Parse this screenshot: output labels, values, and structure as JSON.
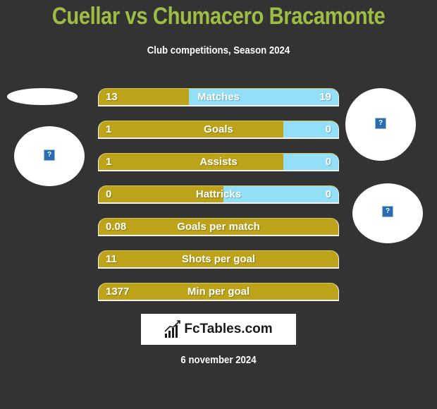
{
  "header": {
    "title": "Cuellar vs Chumacero Bracamonte",
    "subtitle": "Club competitions, Season 2024"
  },
  "colors": {
    "title": "#9dbd45",
    "left_bar": "#bca31a",
    "right_bar": "#93dff7",
    "background": "#333333"
  },
  "stats": [
    {
      "label": "Matches",
      "left": "13",
      "right": "19",
      "left_share": 0.375
    },
    {
      "label": "Goals",
      "left": "1",
      "right": "0",
      "left_share": 0.77
    },
    {
      "label": "Assists",
      "left": "1",
      "right": "0",
      "left_share": 0.77
    },
    {
      "label": "Hattricks",
      "left": "0",
      "right": "0",
      "left_share": 0.52
    },
    {
      "label": "Goals per match",
      "left": "0.08",
      "right": "",
      "left_share": 1.0
    },
    {
      "label": "Shots per goal",
      "left": "11",
      "right": "",
      "left_share": 1.0
    },
    {
      "label": "Min per goal",
      "left": "1377",
      "right": "",
      "left_share": 1.0
    }
  ],
  "logos": {
    "placeholder_glyph": "?",
    "left_team": "team-logo-placeholder",
    "right_team": "team-logo-placeholder"
  },
  "brand": {
    "name": "FcTables.com",
    "icon": "bar-chart-icon"
  },
  "footer": {
    "date": "6 november 2024"
  }
}
